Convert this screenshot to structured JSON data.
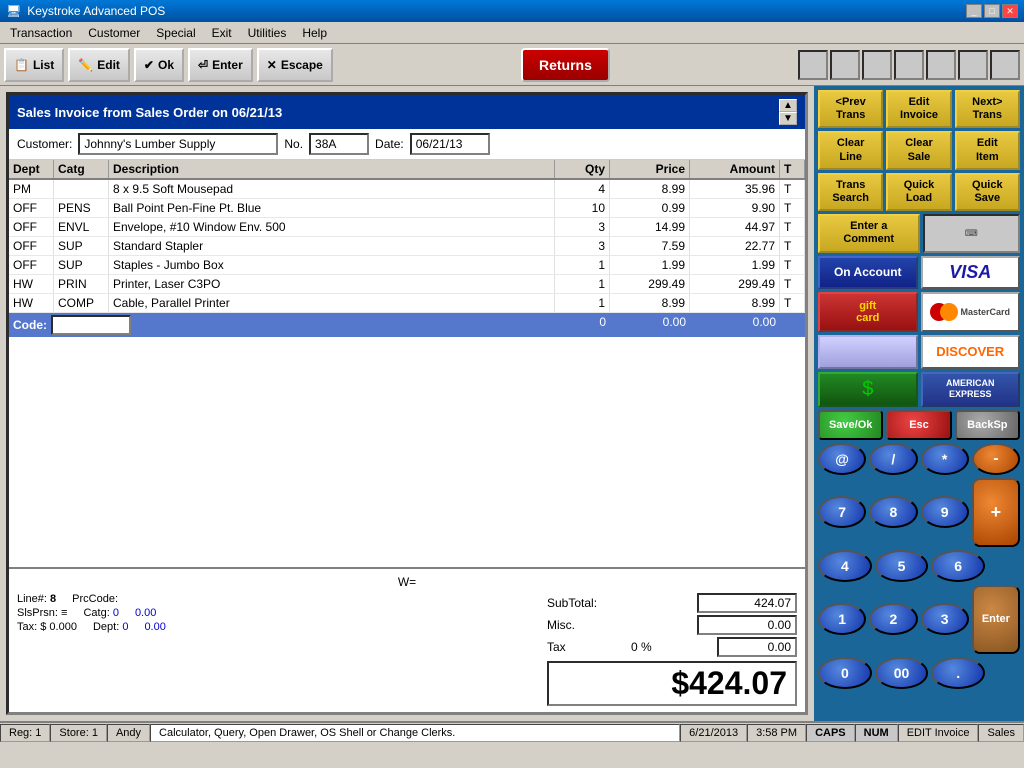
{
  "window": {
    "title": "Keystroke Advanced POS",
    "icon": "pos-icon"
  },
  "menu": {
    "items": [
      "Transaction",
      "Customer",
      "Special",
      "Exit",
      "Utilities",
      "Help"
    ]
  },
  "toolbar": {
    "list_label": "List",
    "edit_label": "Edit",
    "ok_label": "Ok",
    "enter_label": "Enter",
    "escape_label": "Escape",
    "returns_label": "Returns"
  },
  "invoice": {
    "title": "Sales Invoice from Sales Order on 06/21/13",
    "customer_label": "Customer:",
    "customer_value": "Johnny's Lumber Supply",
    "no_label": "No.",
    "no_value": "38A",
    "date_label": "Date:",
    "date_value": "06/21/13"
  },
  "table": {
    "columns": [
      "Dept",
      "Catg",
      "Description",
      "Qty",
      "Price",
      "Amount",
      "T"
    ],
    "rows": [
      {
        "dept": "PM",
        "catg": "",
        "desc": "8 x 9.5 Soft Mousepad",
        "qty": "4",
        "price": "8.99",
        "amount": "35.96",
        "t": "T"
      },
      {
        "dept": "OFF",
        "catg": "PENS",
        "desc": "Ball Point Pen-Fine Pt. Blue",
        "qty": "10",
        "price": "0.99",
        "amount": "9.90",
        "t": "T"
      },
      {
        "dept": "OFF",
        "catg": "ENVL",
        "desc": "Envelope, #10 Window Env. 500",
        "qty": "3",
        "price": "14.99",
        "amount": "44.97",
        "t": "T"
      },
      {
        "dept": "OFF",
        "catg": "SUP",
        "desc": "Standard Stapler",
        "qty": "3",
        "price": "7.59",
        "amount": "22.77",
        "t": "T"
      },
      {
        "dept": "OFF",
        "catg": "SUP",
        "desc": "Staples - Jumbo Box",
        "qty": "1",
        "price": "1.99",
        "amount": "1.99",
        "t": "T"
      },
      {
        "dept": "HW",
        "catg": "PRIN",
        "desc": "Printer, Laser C3PO",
        "qty": "1",
        "price": "299.49",
        "amount": "299.49",
        "t": "T"
      },
      {
        "dept": "HW",
        "catg": "COMP",
        "desc": "Cable, Parallel Printer",
        "qty": "1",
        "price": "8.99",
        "amount": "8.99",
        "t": "T"
      }
    ],
    "code_row": {
      "label": "Code:",
      "qty": "0",
      "price": "0.00",
      "amount": "0.00"
    }
  },
  "footer": {
    "w_label": "W=",
    "line_label": "Line#:",
    "line_value": "8",
    "prccode_label": "PrcCode:",
    "slsprsn_label": "SlsPrsn:",
    "slsprsn_value": "≡",
    "catg_label": "Catg:",
    "catg_value": "0",
    "catg_amount": "0.00",
    "tax_label": "Tax:",
    "tax_value": "$ 0.000",
    "dept_label": "Dept:",
    "dept_value": "0",
    "dept_amount": "0.00",
    "subtotal_label": "SubTotal:",
    "subtotal_value": "424.07",
    "misc_label": "Misc.",
    "misc_value": "0.00",
    "tax_pct_label": "Tax",
    "tax_pct": "0 %",
    "tax_amount": "0.00",
    "total": "$424.07"
  },
  "right_panel": {
    "prev_trans": "<Prev\nTrans",
    "edit_invoice": "Edit\nInvoice",
    "next_trans": "Next>\nTrans",
    "clear_line": "Clear\nLine",
    "clear_sale": "Clear\nSale",
    "edit_item": "Edit\nItem",
    "trans_search": "Trans\nSearch",
    "quick_load": "Quick\nLoad",
    "quick_save": "Quick\nSave",
    "enter_comment": "Enter a\nComment",
    "on_account": "On Account",
    "visa": "VISA",
    "gift_card": "gift card",
    "mastercard": "MasterCard",
    "check": "",
    "discover": "DISCOVER",
    "cash": "",
    "amex": "AMERICAN\nEXPRESS",
    "numpad": {
      "save_ok": "Save/Ok",
      "esc": "Esc",
      "backsp": "BackSp",
      "at": "@",
      "slash": "/",
      "star": "*",
      "minus": "-",
      "n7": "7",
      "n8": "8",
      "n9": "9",
      "plus": "+",
      "n4": "4",
      "n5": "5",
      "n6": "6",
      "n1": "1",
      "n2": "2",
      "n3": "3",
      "enter": "Enter",
      "n0": "0",
      "n00": "00",
      "dot": "."
    }
  },
  "status_bar": {
    "reg": "Reg: 1",
    "store": "Store: 1",
    "user": "Andy",
    "mode": "EDIT Invoice",
    "message": "Calculator, Query, Open Drawer, OS Shell or Change Clerks.",
    "date": "6/21/2013",
    "time": "3:58 PM",
    "caps": "CAPS",
    "num": "NUM",
    "sales": "Sales"
  }
}
